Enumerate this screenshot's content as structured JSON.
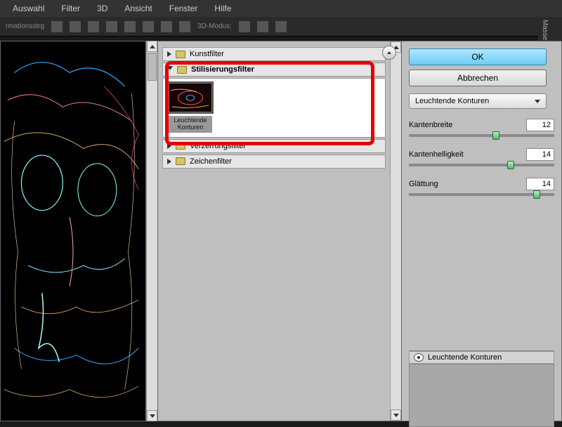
{
  "menu": [
    "Auswahl",
    "Filter",
    "3D",
    "Ansicht",
    "Fenster",
    "Hilfe"
  ],
  "toolbar": {
    "left_label": "rmationsstrg",
    "mode_label": "3D-Modus:"
  },
  "right_panel_tab": "Masse Kol",
  "filter_groups": {
    "kunstfilter": "Kunstfilter",
    "stilisierung": "Stilisierungsfilter",
    "verzerrung": "Verzerrungsfilter",
    "zeichen": "Zeichenfilter"
  },
  "thumbs": {
    "leuchtende": {
      "label": "Leuchtende Konturen"
    }
  },
  "buttons": {
    "ok": "OK",
    "cancel": "Abbrechen"
  },
  "dropdown_value": "Leuchtende Konturen",
  "params": {
    "kantenbreite": {
      "label": "Kantenbreite",
      "value": "12",
      "pos": 60
    },
    "kantenhelligkeit": {
      "label": "Kantenhelligkeit",
      "value": "14",
      "pos": 70
    },
    "glaettung": {
      "label": "Glättung",
      "value": "14",
      "pos": 88
    }
  },
  "effect_stack_title": "Leuchtende Konturen"
}
